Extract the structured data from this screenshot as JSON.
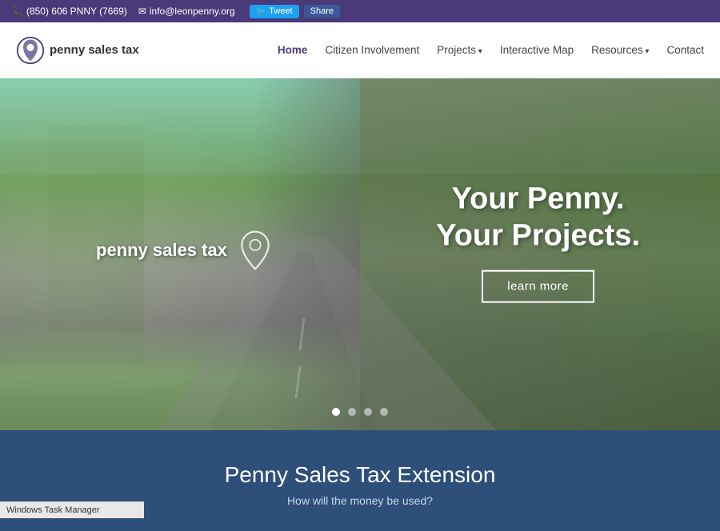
{
  "topbar": {
    "phone": "(850) 606 PNNY (7669)",
    "email": "info@leonpenny.org",
    "tweet_label": "Tweet",
    "share_label": "Share"
  },
  "nav": {
    "logo_text": "penny sales tax",
    "links": [
      {
        "label": "Home",
        "active": true,
        "has_arrow": false
      },
      {
        "label": "Citizen Involvement",
        "active": false,
        "has_arrow": false
      },
      {
        "label": "Projects",
        "active": false,
        "has_arrow": true
      },
      {
        "label": "Interactive Map",
        "active": false,
        "has_arrow": false
      },
      {
        "label": "Resources",
        "active": false,
        "has_arrow": true
      },
      {
        "label": "Contact",
        "active": false,
        "has_arrow": false
      }
    ]
  },
  "hero": {
    "logo_text": "penny sales tax",
    "title_line1": "Your Penny.",
    "title_line2": "Your Projects.",
    "cta_label": "learn more",
    "dots": [
      {
        "active": true
      },
      {
        "active": false
      },
      {
        "active": false
      },
      {
        "active": false
      }
    ]
  },
  "section": {
    "title": "Penny Sales Tax Extension",
    "subtitle": "How will the money be used?"
  },
  "taskbar": {
    "label": "Windows Task Manager"
  },
  "icons": {
    "phone": "📞",
    "email": "✉",
    "twitter": "🐦"
  }
}
